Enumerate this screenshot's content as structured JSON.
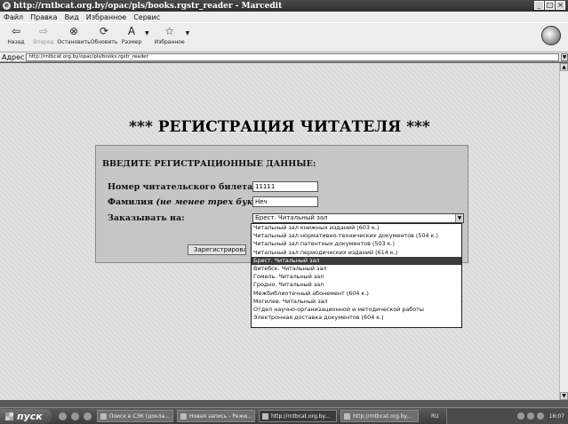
{
  "window": {
    "title": "http://rntbcat.org.by/opac/pls/books.rgstr_reader - Marcedit",
    "ie_icon": "ie-icon",
    "buttons": [
      "_",
      "□",
      "×"
    ]
  },
  "menu": [
    "Файл",
    "Правка",
    "Вид",
    "Избранное",
    "Сервис"
  ],
  "toolbar": {
    "back": "Назад",
    "forward": "Вперед",
    "stop": "Остановить",
    "refresh": "Обновить",
    "size": "Размер",
    "favorites": "Избранное"
  },
  "address": {
    "label": "Адрес",
    "url": "http://rntbcat.org.by/opac/pls/books.rgstr_reader"
  },
  "page": {
    "title": "*** РЕГИСТРАЦИЯ ЧИТАТЕЛЯ ***",
    "heading": "ВВЕДИТЕ РЕГИСТРАЦИОННЫЕ ДАННЫЕ:",
    "ticket_label": "Номер читательского билета:",
    "ticket_value": "11111",
    "surname_label": "Фамилия",
    "surname_hint": "(не менее трех букв)",
    "surname_colon": ":",
    "surname_value": "Нeч",
    "order_label": "Заказывать на:",
    "order_selected": "Брест. Читальный зал",
    "submit_label": "Зарегистрироваться",
    "options": [
      "Читальный зал книжных изданий (603 к.)",
      "Читальный зал нормативно-технических документов (504 к.)",
      "Читальный зал патентных документов (503 к.)",
      "Читальный зал периодических изданий (614 к.)",
      "Брест. Читальный зал",
      "Витебск. Читальный зал",
      "Гомель. Читальный зал",
      "Гродно. Читальный зал",
      "Межбиблиотечный абонемент (604 к.)",
      "Могилев. Читальный зал",
      "Отдел научно-организационной и методической работы",
      "Электронная доставка документов (604 к.)"
    ],
    "selected_index": 4
  },
  "taskbar": {
    "start": "пуск",
    "tasks": [
      "Поиск в СЭК (докла...",
      "Новая запись - Режи...",
      "http://rntbcat.org.by...",
      "http://rntbcat.org.by..."
    ],
    "active_task": 2,
    "lang": "RU",
    "clock": "16:07"
  }
}
